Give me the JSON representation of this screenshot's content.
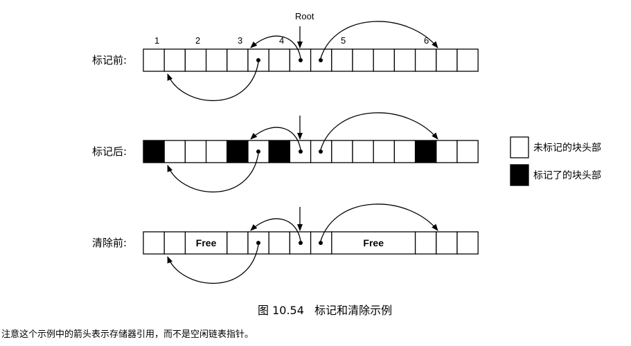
{
  "diagram": {
    "root_label": "Root",
    "block_numbers": [
      "1",
      "2",
      "3",
      "4",
      "5",
      "6"
    ],
    "rows": [
      {
        "label": "标记前:",
        "marked": [],
        "free": []
      },
      {
        "label": "标记后:",
        "marked": [
          0,
          4,
          6,
          13
        ],
        "free": []
      },
      {
        "label": "清除前:",
        "marked": [],
        "free": [
          {
            "start": 2,
            "span": 2,
            "text": "Free"
          },
          {
            "start": 9,
            "span": 4,
            "text": "Free"
          }
        ]
      }
    ],
    "legend": [
      {
        "kind": "unmarked",
        "text": "未标记的块头部"
      },
      {
        "kind": "marked",
        "text": "标记了的块头部"
      }
    ]
  },
  "caption": "图 10.54   标记和清除示例",
  "note": "注意这个示例中的箭头表示存储器引用，而不是空闲链表指针。",
  "colors": {
    "marked": "#000000",
    "line": "#000000",
    "background": "#ffffff"
  }
}
